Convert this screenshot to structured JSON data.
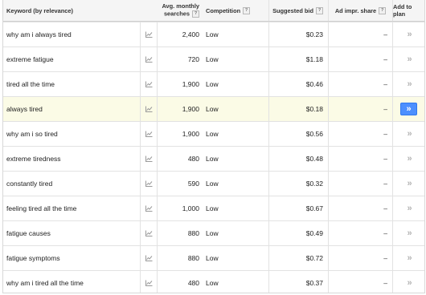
{
  "header": {
    "keyword": "Keyword (by relevance)",
    "avg_line1": "Avg. monthly",
    "avg_line2": "searches",
    "competition": "Competition",
    "suggested_bid": "Suggested bid",
    "ad_impr_share": "Ad impr. share",
    "add_to_plan": "Add to plan",
    "help_glyph": "?"
  },
  "add_glyph": "»",
  "rows": [
    {
      "keyword": "why am i always tired",
      "searches": "2,400",
      "competition": "Low",
      "bid": "$0.23",
      "impr_share": "–"
    },
    {
      "keyword": "extreme fatigue",
      "searches": "720",
      "competition": "Low",
      "bid": "$1.18",
      "impr_share": "–"
    },
    {
      "keyword": "tired all the time",
      "searches": "1,900",
      "competition": "Low",
      "bid": "$0.46",
      "impr_share": "–"
    },
    {
      "keyword": "always tired",
      "searches": "1,900",
      "competition": "Low",
      "bid": "$0.18",
      "impr_share": "–",
      "highlighted": true
    },
    {
      "keyword": "why am i so tired",
      "searches": "1,900",
      "competition": "Low",
      "bid": "$0.56",
      "impr_share": "–"
    },
    {
      "keyword": "extreme tiredness",
      "searches": "480",
      "competition": "Low",
      "bid": "$0.48",
      "impr_share": "–"
    },
    {
      "keyword": "constantly tired",
      "searches": "590",
      "competition": "Low",
      "bid": "$0.32",
      "impr_share": "–"
    },
    {
      "keyword": "feeling tired all the time",
      "searches": "1,000",
      "competition": "Low",
      "bid": "$0.67",
      "impr_share": "–"
    },
    {
      "keyword": "fatigue causes",
      "searches": "880",
      "competition": "Low",
      "bid": "$0.49",
      "impr_share": "–"
    },
    {
      "keyword": "fatigue symptoms",
      "searches": "880",
      "competition": "Low",
      "bid": "$0.72",
      "impr_share": "–"
    },
    {
      "keyword": "why am i tired all the time",
      "searches": "480",
      "competition": "Low",
      "bid": "$0.37",
      "impr_share": "–"
    }
  ],
  "icons": {
    "trend": "trend-chart-icon",
    "help": "help-icon",
    "add": "add-to-plan-icon"
  },
  "colors": {
    "highlight_row": "#fbfbe6",
    "add_button": "#4d90fe"
  }
}
